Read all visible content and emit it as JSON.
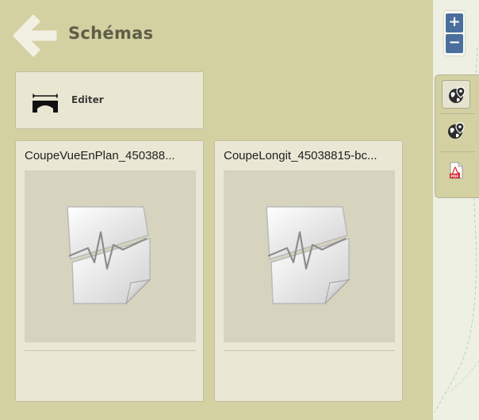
{
  "header": {
    "title": "Schémas",
    "back_icon": "arrow-left-icon"
  },
  "edit_card": {
    "label": "Editer",
    "icon": "bridge-icon"
  },
  "documents": [
    {
      "title": "CoupeVueEnPlan_450388...",
      "icon": "document-chart-icon"
    },
    {
      "title": "CoupeLongit_45038815-bc...",
      "icon": "document-chart-icon"
    }
  ],
  "map_controls": {
    "zoom_in": "+",
    "zoom_out": "−"
  },
  "toolbar": {
    "items": [
      {
        "icon": "globe-pin-icon",
        "active": true
      },
      {
        "icon": "globe-pin-icon",
        "active": false
      },
      {
        "icon": "pdf-icon",
        "active": false
      }
    ]
  },
  "colors": {
    "panel_bg": "#d3d0a2",
    "card_bg": "#eae8d4",
    "zoom_bg": "#4a6f9e",
    "title_color": "#5e5e46"
  }
}
